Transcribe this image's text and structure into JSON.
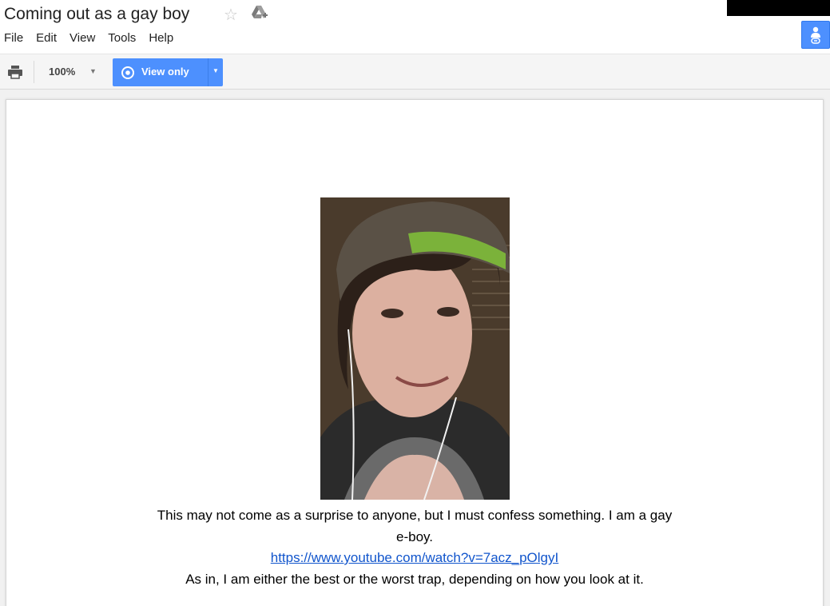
{
  "window": {
    "title": "Coming out as a gay boy",
    "star_icon": "star-outline-icon",
    "drive_icon": "drive-add-icon"
  },
  "menu": [
    "File",
    "Edit",
    "View",
    "Tools",
    "Help"
  ],
  "toolbar": {
    "zoom": "100%",
    "view_mode_label": "View only"
  },
  "document": {
    "line1": "This may not come as a surprise to anyone, but I must confess something. I am a gay",
    "line2": "e-boy.",
    "link": "https://www.youtube.com/watch?v=7acz_pOlgyI",
    "line3": "As in, I am either the best or the worst trap, depending on how you look at it."
  },
  "colors": {
    "accent": "#4d90fe",
    "link": "#1155cc"
  }
}
